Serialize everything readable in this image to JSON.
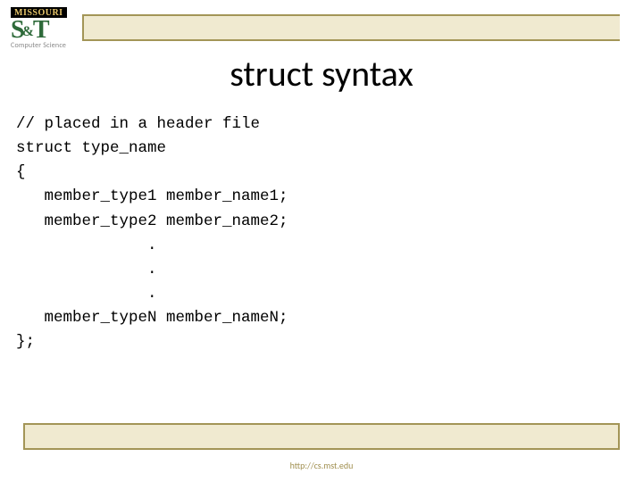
{
  "logo": {
    "top": "MISSOURI",
    "s": "S",
    "amp": "&",
    "t": "T",
    "sub": "Computer Science"
  },
  "title": "struct syntax",
  "code": {
    "l1": "// placed in a header file",
    "l2": "struct type_name",
    "l3": "{",
    "l4": "   member_type1 member_name1;",
    "l5": "   member_type2 member_name2;",
    "l6": "              .",
    "l7": "              .",
    "l8": "              .",
    "l9": "   member_typeN member_nameN;",
    "l10": "};"
  },
  "footer": "http://cs.mst.edu"
}
